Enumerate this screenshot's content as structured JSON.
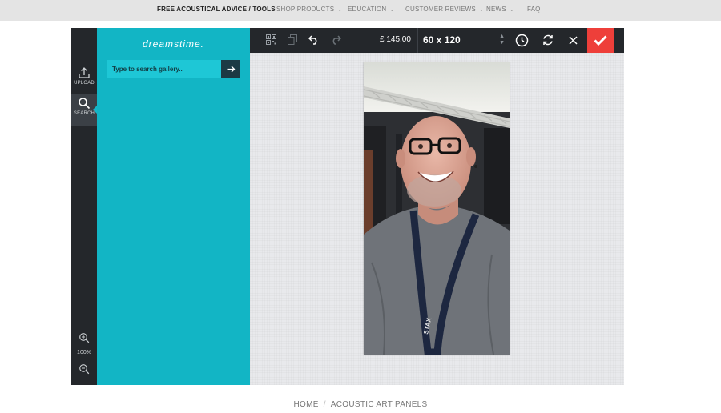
{
  "topnav": {
    "items": [
      {
        "label": "FREE ACOUSTICAL ADVICE / TOOLS",
        "active": true,
        "dropdown": false
      },
      {
        "label": "SHOP PRODUCTS",
        "active": false,
        "dropdown": true
      },
      {
        "label": "EDUCATION",
        "active": false,
        "dropdown": true
      },
      {
        "label": "CUSTOMER REVIEWS",
        "active": false,
        "dropdown": true
      },
      {
        "label": "NEWS",
        "active": false,
        "dropdown": true
      },
      {
        "label": "FAQ",
        "active": false,
        "dropdown": false
      }
    ]
  },
  "rail": {
    "upload_label": "UPLOAD",
    "search_label": "SEARCH",
    "zoom_label": "100%"
  },
  "panel": {
    "logo": "dreamstime.",
    "search_placeholder": "Type to search gallery.."
  },
  "toolbar": {
    "price": "£ 145.00",
    "size": "60 x 120",
    "icons": [
      "qr-icon",
      "copy-icon",
      "undo-icon",
      "redo-icon",
      "clock-icon",
      "refresh-icon",
      "close-icon",
      "check-icon"
    ]
  },
  "colors": {
    "accent": "#12b5c5",
    "toolbar": "#24272b",
    "confirm": "#ee3f3a"
  },
  "breadcrumb": {
    "home": "HOME",
    "current": "ACOUSTIC ART PANELS"
  }
}
